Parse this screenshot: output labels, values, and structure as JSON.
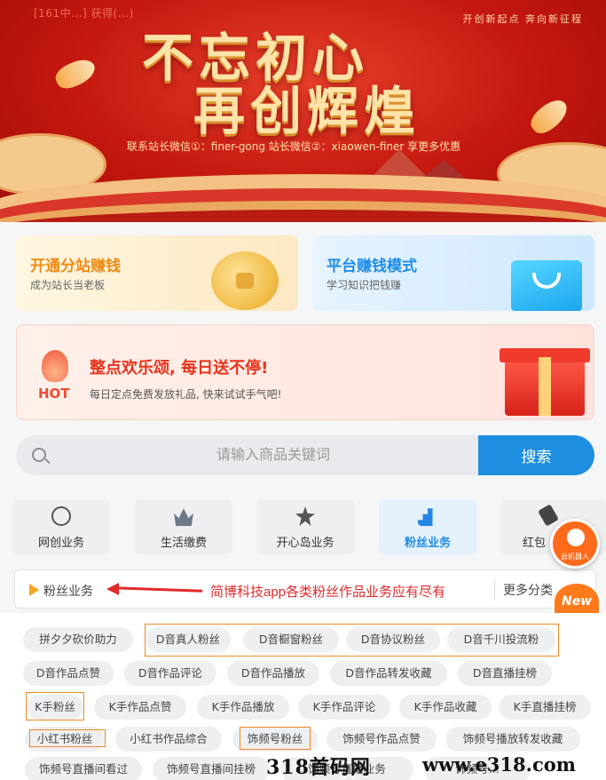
{
  "banner": {
    "marquee": "[161中...] 获得(...)",
    "slogan": "开创新起点 奔向新征程",
    "title_line1": "不忘初心",
    "title_line2": "再创辉煌",
    "contact": "联系站长微信①：finer-gong   站长微信②：xiaowen-finer 享更多优惠"
  },
  "cards": {
    "left": {
      "title": "开通分站赚钱",
      "subtitle": "成为站长当老板",
      "icon": "coin-icon"
    },
    "right": {
      "title": "平台赚钱模式",
      "subtitle": "学习知识把钱赚",
      "icon": "shopping-bag-icon"
    }
  },
  "hot": {
    "badge": "HOT",
    "title": "整点欢乐颂, 每日送不停!",
    "subtitle": "每日定点免费发放礼品, 快来试试手气吧!",
    "icon": "gift-box-icon"
  },
  "search": {
    "placeholder": "请输入商品关键词",
    "button": "搜索"
  },
  "tabs": [
    {
      "label": "网创业务",
      "icon": "globe-icon"
    },
    {
      "label": "生活缴费",
      "icon": "crown-icon"
    },
    {
      "label": "开心岛业务",
      "icon": "star-icon"
    },
    {
      "label": "粉丝业务",
      "icon": "fans-chart-icon",
      "active": true
    },
    {
      "label": "红包",
      "icon": "red-packet-icon"
    }
  ],
  "floating": {
    "service_label": "云机器人",
    "new_label": "New"
  },
  "fans_bar": {
    "title": "粉丝业务",
    "annotation": "简博科技app各类粉丝作品业务应有尽有",
    "more": "更多分类"
  },
  "chips": {
    "row1": [
      "拼夕夕砍价助力",
      "D音真人粉丝",
      "D音橱窗粉丝",
      "D音协议粉丝",
      "D音千川投流粉"
    ],
    "row2": [
      "D音作品点赞",
      "D音作品评论",
      "D音作品播放",
      "D音作品转发收藏",
      "D音直播挂榜"
    ],
    "row3": [
      "K手粉丝",
      "K手作品点赞",
      "K手作品播放",
      "K手作品评论",
      "K手作品收藏",
      "K手直播挂榜"
    ],
    "row4": [
      "小红书粉丝",
      "小红书作品综合",
      "饰频号粉丝",
      "饰频号作品点赞",
      "饰频号播放转发收藏"
    ],
    "row5": [
      "饰频号直播间看过",
      "饰频号直播间挂榜",
      "饰频号直播业务",
      "饰频号..."
    ]
  },
  "watermark": {
    "left": "318首码网",
    "right": "www.e318.com"
  },
  "colors": {
    "brand_blue": "#1e8fe0",
    "hot_red": "#e7341c",
    "orange": "#f08a12",
    "annotation_red": "#e02a2a"
  }
}
